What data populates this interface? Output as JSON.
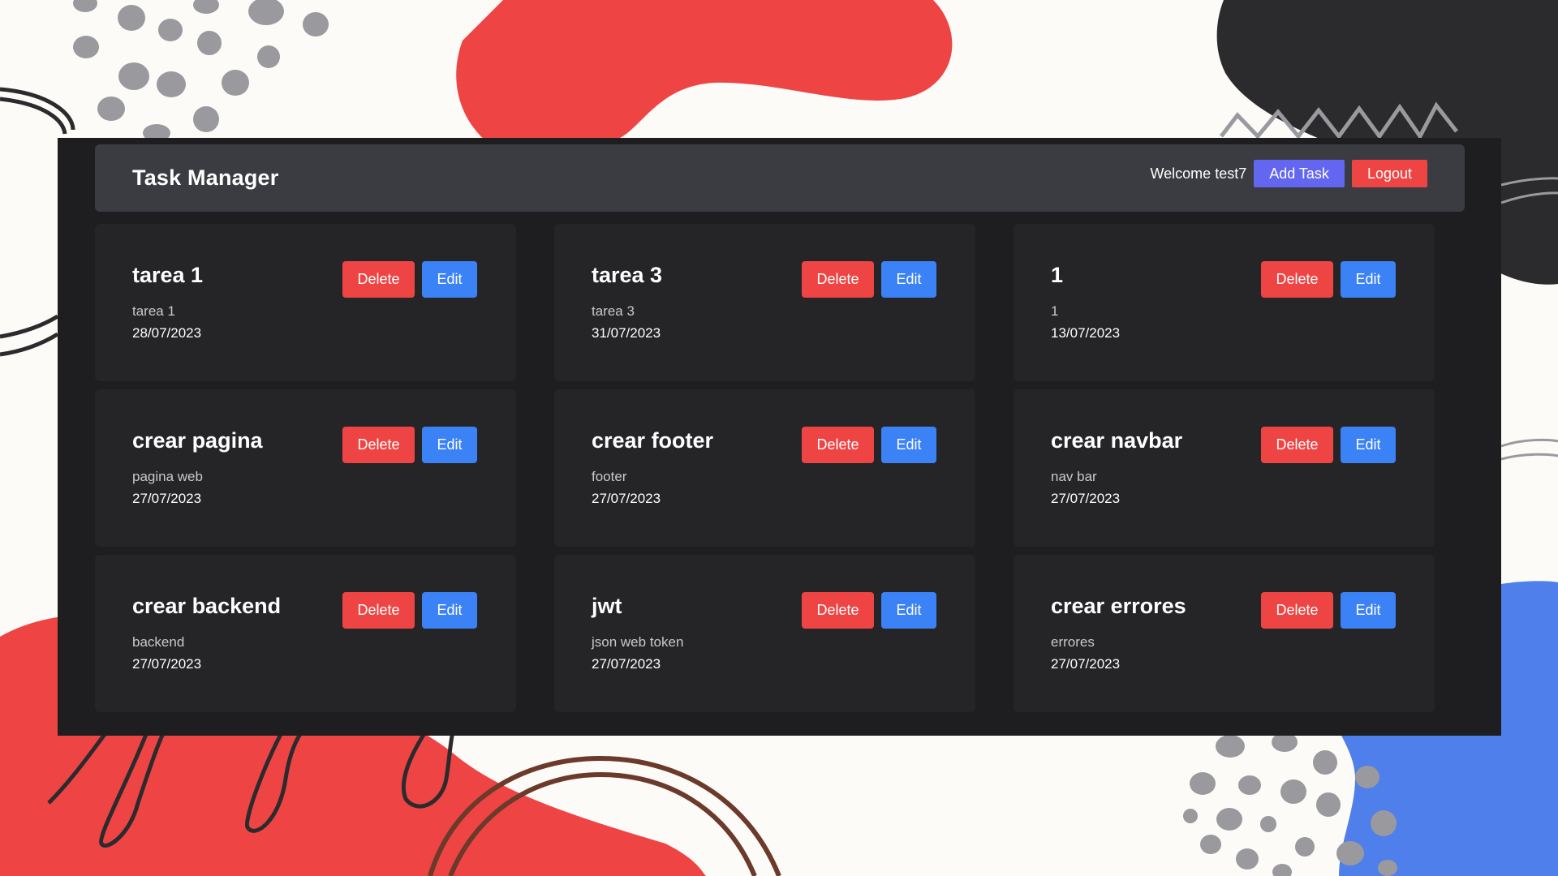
{
  "header": {
    "title": "Task Manager",
    "welcome": "Welcome test7",
    "add_task_label": "Add Task",
    "logout_label": "Logout"
  },
  "tasks": [
    {
      "title": "tarea 1",
      "description": "tarea 1",
      "date": "28/07/2023",
      "delete_label": "Delete",
      "edit_label": "Edit"
    },
    {
      "title": "tarea 3",
      "description": "tarea 3",
      "date": "31/07/2023",
      "delete_label": "Delete",
      "edit_label": "Edit"
    },
    {
      "title": "1",
      "description": "1",
      "date": "13/07/2023",
      "delete_label": "Delete",
      "edit_label": "Edit"
    },
    {
      "title": "crear pagina",
      "description": "pagina web",
      "date": "27/07/2023",
      "delete_label": "Delete",
      "edit_label": "Edit"
    },
    {
      "title": "crear footer",
      "description": "footer",
      "date": "27/07/2023",
      "delete_label": "Delete",
      "edit_label": "Edit"
    },
    {
      "title": "crear navbar",
      "description": "nav bar",
      "date": "27/07/2023",
      "delete_label": "Delete",
      "edit_label": "Edit"
    },
    {
      "title": "crear backend",
      "description": "backend",
      "date": "27/07/2023",
      "delete_label": "Delete",
      "edit_label": "Edit"
    },
    {
      "title": "jwt",
      "description": "json web token",
      "date": "27/07/2023",
      "delete_label": "Delete",
      "edit_label": "Edit"
    },
    {
      "title": "crear errores",
      "description": "errores",
      "date": "27/07/2023",
      "delete_label": "Delete",
      "edit_label": "Edit"
    }
  ],
  "colors": {
    "background": "#fcfbf8",
    "panel": "#1e1e20",
    "header": "#3b3c42",
    "card": "#252528",
    "delete": "#ef4444",
    "edit": "#3b82f6",
    "add_task": "#6366f1",
    "logout": "#ef4444",
    "decor_red": "#ef4444",
    "decor_blue": "#4f7fea",
    "decor_dark": "#2b2b2d",
    "decor_gray": "#9a9a9e"
  }
}
